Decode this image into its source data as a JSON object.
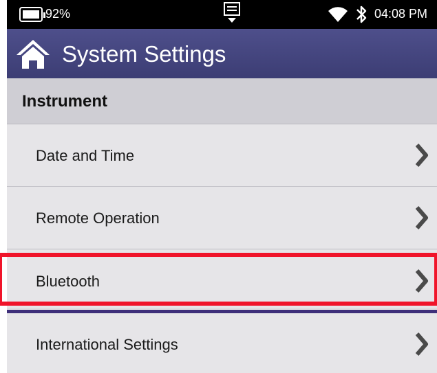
{
  "status_bar": {
    "battery": "92%",
    "time": "04:08 PM",
    "icons": [
      "battery-icon",
      "notification-icon",
      "wifi-icon",
      "bluetooth-icon"
    ]
  },
  "header": {
    "title": "System Settings",
    "home_icon": "home-icon"
  },
  "section": {
    "label": "Instrument"
  },
  "items": [
    {
      "label": "Date and Time"
    },
    {
      "label": "Remote Operation"
    },
    {
      "label": "Bluetooth",
      "selected": true
    },
    {
      "label": "International Settings"
    }
  ],
  "colors": {
    "title_bar": "#4a4b85",
    "highlight": "#f0142a",
    "list_bg": "#e6e5e8"
  }
}
